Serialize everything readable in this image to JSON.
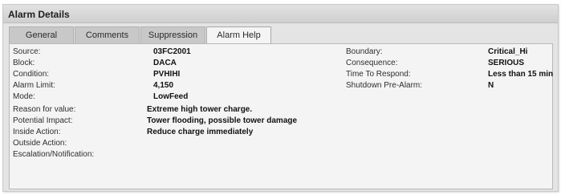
{
  "panel": {
    "title": "Alarm Details"
  },
  "tabs": [
    {
      "label": "General",
      "active": false
    },
    {
      "label": "Comments",
      "active": false
    },
    {
      "label": "Suppression",
      "active": false
    },
    {
      "label": "Alarm Help",
      "active": true
    }
  ],
  "left_fields": [
    {
      "label": "Source:",
      "value": "03FC2001"
    },
    {
      "label": "Block:",
      "value": "DACA"
    },
    {
      "label": "Condition:",
      "value": "PVHIHI"
    },
    {
      "label": "Alarm Limit:",
      "value": "4,150"
    },
    {
      "label": "Mode:",
      "value": "LowFeed"
    }
  ],
  "right_fields": [
    {
      "label": "Boundary:",
      "value": "Critical_Hi"
    },
    {
      "label": "Consequence:",
      "value": "SERIOUS"
    },
    {
      "label": "Time To Respond:",
      "value": "Less than 15 min"
    },
    {
      "label": "Shutdown Pre-Alarm:",
      "value": "N"
    }
  ],
  "help_fields": [
    {
      "label": "Reason for value:",
      "value": "Extreme high tower charge."
    },
    {
      "label": "Potential Impact:",
      "value": "Tower flooding, possible tower damage"
    },
    {
      "label": "Inside Action:",
      "value": "Reduce charge immediately"
    },
    {
      "label": "Outside Action:",
      "value": ""
    },
    {
      "label": "Escalation/Notification:",
      "value": ""
    }
  ]
}
